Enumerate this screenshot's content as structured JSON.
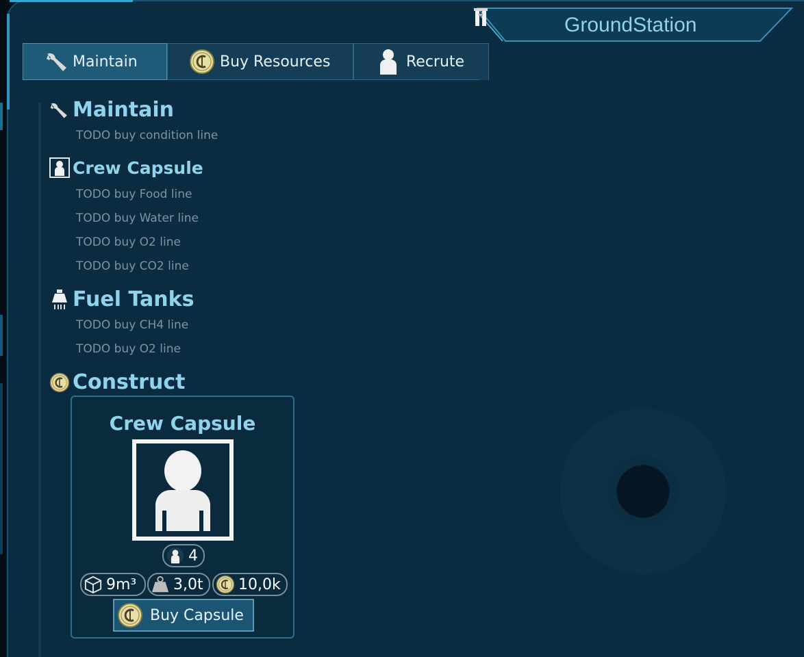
{
  "header": {
    "title": "GroundStation"
  },
  "tabs": [
    {
      "label": "Maintain",
      "icon": "wrench-icon"
    },
    {
      "label": "Buy Resources",
      "icon": "credits-coin-icon"
    },
    {
      "label": "Recrute",
      "icon": "crew-person-icon"
    }
  ],
  "sections": {
    "maintain": {
      "title": "Maintain",
      "lines": [
        "TODO buy condition line"
      ]
    },
    "crew_capsule": {
      "title": "Crew Capsule",
      "lines": [
        "TODO buy Food line",
        "TODO buy Water line",
        "TODO buy O2 line",
        "TODO buy CO2 line"
      ]
    },
    "fuel_tanks": {
      "title": "Fuel Tanks",
      "lines": [
        "TODO buy CH4 line",
        "TODO buy O2 line"
      ]
    },
    "construct": {
      "title": "Construct"
    }
  },
  "card": {
    "title": "Crew Capsule",
    "crew": "4",
    "volume": "9m³",
    "mass": "3,0t",
    "cost": "10,0k",
    "button": "Buy Capsule"
  },
  "colors": {
    "accent": "#8fd3ec",
    "panel": "#0a2b40",
    "coin": "#e8dfa6"
  }
}
